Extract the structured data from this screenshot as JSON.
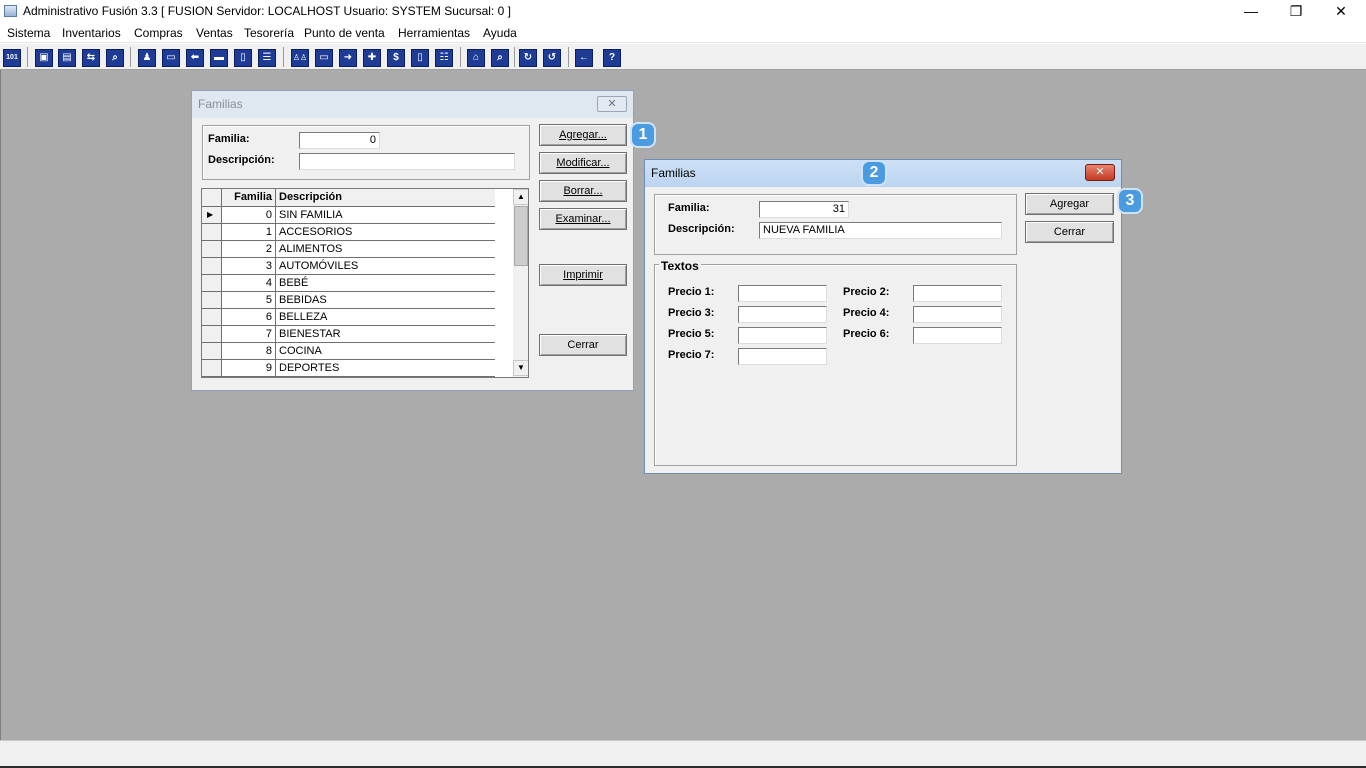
{
  "window": {
    "title": "Administrativo Fusión 3.3 [ FUSION   Servidor: LOCALHOST   Usuario: SYSTEM    Sucursal: 0 ]",
    "minimize": "—",
    "maximize": "❐",
    "close": "✕"
  },
  "menu": [
    "Sistema",
    "Inventarios",
    "Compras",
    "Ventas",
    "Tesorería",
    "Punto de venta",
    "Herramientas",
    "Ayuda"
  ],
  "toolbar_icons": [
    "101-icon",
    "copy-icon",
    "clipboard-icon",
    "transfer-icon",
    "search-doc-icon",
    "user-icon",
    "folder-icon",
    "import-icon",
    "print-icon",
    "document-icon",
    "list-icon",
    "people-icon",
    "box-icon",
    "export-icon",
    "add-icon",
    "dollar-icon",
    "report-icon",
    "table-icon",
    "home-icon",
    "zoom-icon",
    "refresh-icon",
    "undo-icon",
    "back-icon",
    "help-icon"
  ],
  "toolbar_glyphs": [
    "101",
    "▣",
    "▤",
    "⇆",
    "⌕",
    "♟",
    "▭",
    "⬅",
    "▬",
    "▯",
    "☰",
    "♙♙",
    "▭",
    "➜",
    "✚",
    "$",
    "▯",
    "☷",
    "⌂",
    "⌕",
    "↻",
    "↺",
    "←",
    "?"
  ],
  "familias_list": {
    "title": "Familias",
    "close": "✕",
    "familia_label": "Familia:",
    "familia_value": "0",
    "descripcion_label": "Descripción:",
    "descripcion_value": "",
    "buttons": {
      "agregar": "Agregar...",
      "modificar": "Modificar...",
      "borrar": "Borrar...",
      "examinar": "Examinar...",
      "imprimir": "Imprimir",
      "cerrar": "Cerrar"
    },
    "grid": {
      "columns": [
        "Familia",
        "Descripción"
      ],
      "current_marker": "▶",
      "rows": [
        {
          "id": "0",
          "desc": "SIN FAMILIA"
        },
        {
          "id": "1",
          "desc": "ACCESORIOS"
        },
        {
          "id": "2",
          "desc": "ALIMENTOS"
        },
        {
          "id": "3",
          "desc": "AUTOMÓVILES"
        },
        {
          "id": "4",
          "desc": "BEBÉ"
        },
        {
          "id": "5",
          "desc": "BEBIDAS"
        },
        {
          "id": "6",
          "desc": "BELLEZA"
        },
        {
          "id": "7",
          "desc": "BIENESTAR"
        },
        {
          "id": "8",
          "desc": "COCINA"
        },
        {
          "id": "9",
          "desc": "DEPORTES"
        }
      ]
    },
    "scroll_up": "▲",
    "scroll_down": "▼"
  },
  "familias_edit": {
    "title": "Familias",
    "close": "✕",
    "familia_label": "Familia:",
    "familia_value": "31",
    "descripcion_label": "Descripción:",
    "descripcion_value": "NUEVA FAMILIA",
    "textos_label": "Textos",
    "precios": [
      {
        "label": "Precio 1:",
        "value": ""
      },
      {
        "label": "Precio 2:",
        "value": ""
      },
      {
        "label": "Precio 3:",
        "value": ""
      },
      {
        "label": "Precio 4:",
        "value": ""
      },
      {
        "label": "Precio 5:",
        "value": ""
      },
      {
        "label": "Precio 6:",
        "value": ""
      },
      {
        "label": "Precio 7:",
        "value": ""
      }
    ],
    "buttons": {
      "agregar": "Agregar",
      "cerrar": "Cerrar"
    }
  },
  "callouts": [
    "1",
    "2",
    "3"
  ]
}
